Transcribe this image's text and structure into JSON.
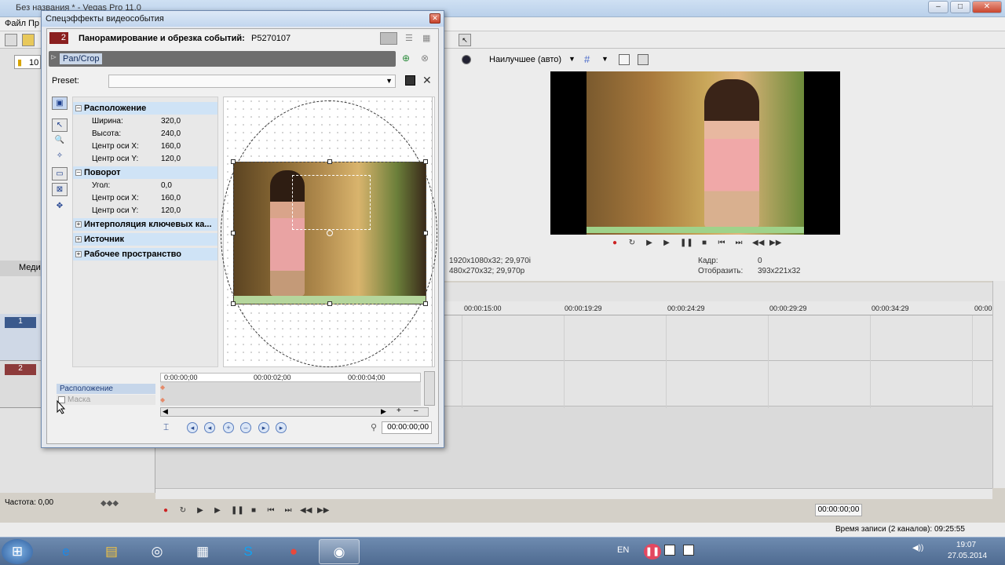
{
  "vegas": {
    "title": "Без названия * - Vegas Pro 11.0",
    "menu": {
      "file": "Файл",
      "edit": "Пр"
    },
    "window_buttons": {
      "minimize": "–",
      "maximize": "□",
      "close": "✕"
    },
    "left_tabs": {
      "media": "Меди"
    },
    "tracks": [
      {
        "number": "1"
      },
      {
        "number": "2"
      }
    ],
    "rate_label": "Частота: 0,00",
    "folder_label": "10"
  },
  "preview": {
    "quality": "Наилучшее (авто)",
    "info_project": "1920x1080x32; 29,970i",
    "info_preview": "480x270x32; 29,970p",
    "frame_label": "Кадр:",
    "frame_value": "0",
    "display_label": "Отобразить:",
    "display_value": "393x221x32"
  },
  "timeline": {
    "ruler": [
      "00:00:15:00",
      "00:00:19:29",
      "00:00:24:29",
      "00:00:29:29",
      "00:00:34:29",
      "00:00"
    ],
    "time_display": "00:00:00;00",
    "record_time": "Время записи (2 каналов): 09:25:55"
  },
  "dialog": {
    "title": "Спецэффекты видеособытия",
    "close": "✕",
    "event_badge": "2",
    "header_title": "Панорамирование и обрезка событий:",
    "header_file": "P5270107",
    "fx_chip": "Pan/Crop",
    "preset_label": "Preset:",
    "sections": [
      {
        "title": "Расположение",
        "expanded": true,
        "props": [
          {
            "k": "Ширина:",
            "v": "320,0"
          },
          {
            "k": "Высота:",
            "v": "240,0"
          },
          {
            "k": "Центр оси X:",
            "v": "160,0"
          },
          {
            "k": "Центр оси Y:",
            "v": "120,0"
          }
        ]
      },
      {
        "title": "Поворот",
        "expanded": true,
        "props": [
          {
            "k": "Угол:",
            "v": "0,0"
          },
          {
            "k": "Центр оси X:",
            "v": "160,0"
          },
          {
            "k": "Центр оси Y:",
            "v": "120,0"
          }
        ]
      },
      {
        "title": "Интерполяция ключевых ка...",
        "expanded": false
      },
      {
        "title": "Источник",
        "expanded": false
      },
      {
        "title": "Рабочее пространство",
        "expanded": false
      }
    ],
    "keyframes": {
      "label_position": "Расположение",
      "label_mask": "Маска",
      "ruler": [
        "0:00:00;00",
        "00:00:02;00",
        "00:00:04;00"
      ],
      "time": "00:00:00;00"
    }
  },
  "taskbar": {
    "lang": "EN",
    "time": "19:07",
    "date": "27.05.2014"
  }
}
